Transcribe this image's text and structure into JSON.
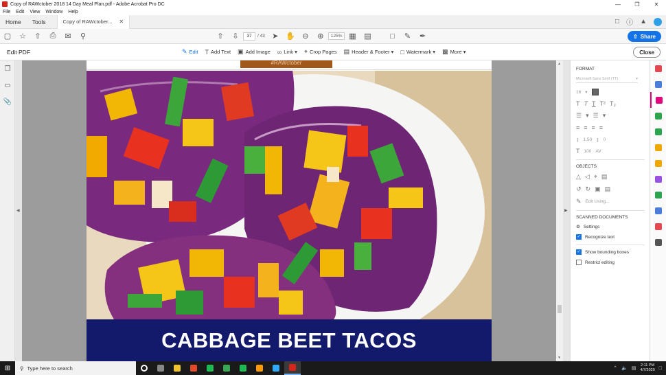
{
  "window": {
    "title": "Copy of RAWctober 2018 14 Day Meal Plan.pdf - Adobe Acrobat Pro DC"
  },
  "menu": [
    "File",
    "Edit",
    "View",
    "Window",
    "Help"
  ],
  "tabs": {
    "home": "Home",
    "tools": "Tools",
    "document": "Copy of RAWctober..."
  },
  "toolbar": {
    "page_current": "37",
    "page_total": "/ 43",
    "zoom": "125%",
    "share_label": "Share"
  },
  "edit_toolbar": {
    "mode_title": "Edit PDF",
    "items": [
      {
        "label": "Edit",
        "icon": "edit-icon",
        "active": true
      },
      {
        "label": "Add Text",
        "icon": "add-text-icon"
      },
      {
        "label": "Add Image",
        "icon": "add-image-icon"
      },
      {
        "label": "Link ▾",
        "icon": "link-icon"
      },
      {
        "label": "Crop Pages",
        "icon": "crop-icon"
      },
      {
        "label": "Header & Footer ▾",
        "icon": "header-footer-icon"
      },
      {
        "label": "Watermark ▾",
        "icon": "watermark-icon"
      },
      {
        "label": "More ▾",
        "icon": "more-icon"
      }
    ],
    "close_label": "Close"
  },
  "document": {
    "header_band_text": "#RAWctober",
    "banner_title": "CABBAGE BEET TACOS",
    "colors": {
      "banner": "#131a6b",
      "header_band": "#a0581b"
    }
  },
  "right_panel": {
    "format_heading": "FORMAT",
    "font_family": "Microsoft Sans Serif (TT)",
    "font_size": "16",
    "line_spacing": "1.50",
    "para_spacing": "0",
    "horiz_scale": "100",
    "char_spacing": "AV",
    "objects_heading": "OBJECTS",
    "edit_using": "Edit Using...",
    "scanned_heading": "SCANNED DOCUMENTS",
    "settings_label": "Settings",
    "recognize_text_label": "Recognize text",
    "recognize_text_checked": true,
    "show_bounding_label": "Show bounding boxes",
    "show_bounding_checked": true,
    "restrict_editing_label": "Restrict editing",
    "restrict_editing_checked": false
  },
  "tool_rail_colors": [
    "#e34850",
    "#4a7cdc",
    "#e6007e",
    "#2da44e",
    "#2da44e",
    "#f0a800",
    "#f0a800",
    "#9b51e0",
    "#2da44e",
    "#4a7cdc",
    "#e34850",
    "#555555"
  ],
  "taskbar": {
    "search_placeholder": "Type here to search",
    "time": "2:11 PM",
    "date": "4/7/2020",
    "app_colors": [
      "#ffffff",
      "#888888",
      "#f0c430",
      "#e04a2a",
      "#1db954",
      "#3aa757",
      "#1db954",
      "#ff9a00",
      "#31a8ff",
      "#d4261a"
    ]
  }
}
